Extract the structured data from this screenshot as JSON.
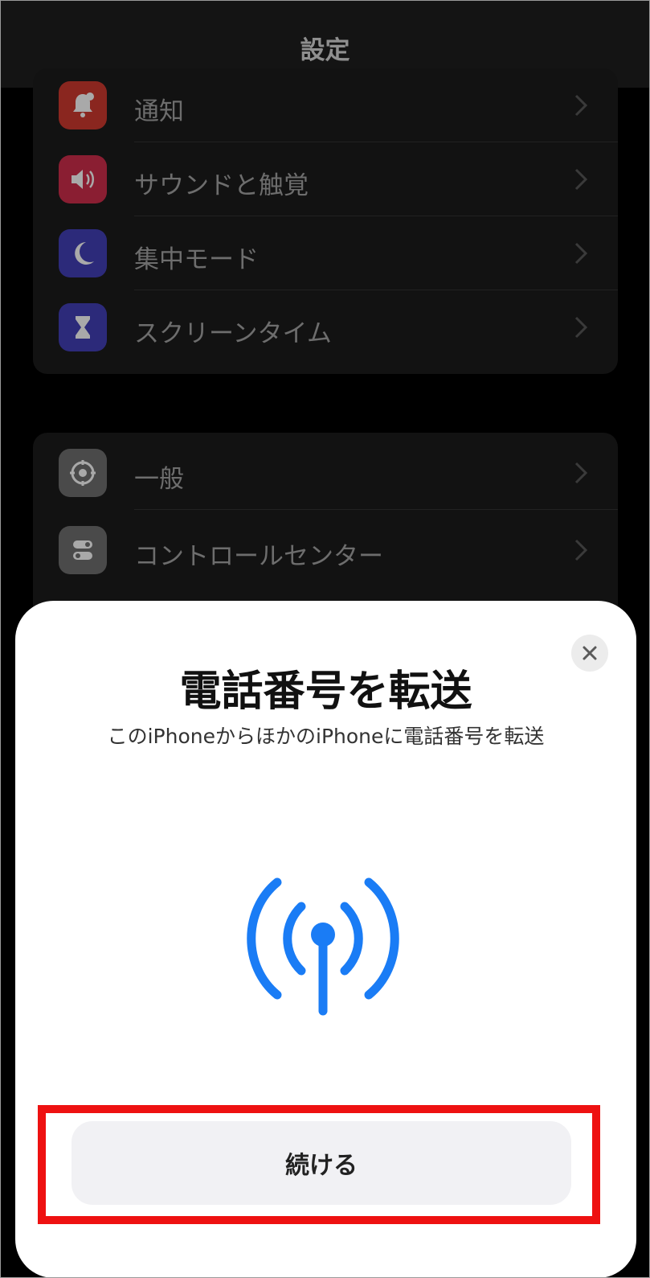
{
  "nav": {
    "title": "設定"
  },
  "group1": {
    "items": [
      {
        "label": "通知",
        "icon": "bell-badge-icon",
        "color": "#c0362c"
      },
      {
        "label": "サウンドと触覚",
        "icon": "speaker-icon",
        "color": "#c02a44"
      },
      {
        "label": "集中モード",
        "icon": "moon-icon",
        "color": "#3d3aa8"
      },
      {
        "label": "スクリーンタイム",
        "icon": "hourglass-icon",
        "color": "#3d3aa8"
      }
    ]
  },
  "group2": {
    "items": [
      {
        "label": "一般",
        "icon": "gear-icon",
        "color": "#6b6b6b"
      },
      {
        "label": "コントロールセンター",
        "icon": "toggles-icon",
        "color": "#6b6b6b"
      }
    ]
  },
  "sheet": {
    "title": "電話番号を転送",
    "subtitle": "このiPhoneからほかのiPhoneに電話番号を転送",
    "illustration": "antenna-signal-icon",
    "accent": "#1a7cf5",
    "continue_label": "続ける"
  },
  "highlight_color": "#ee1111"
}
